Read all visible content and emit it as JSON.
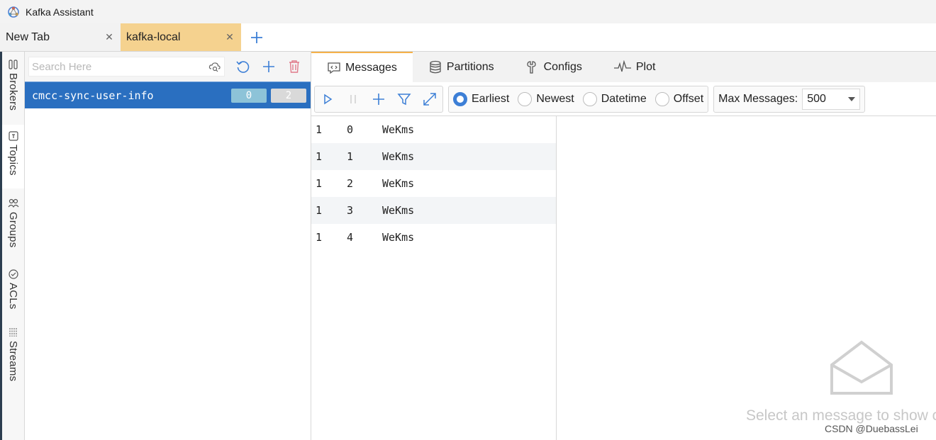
{
  "app": {
    "title": "Kafka Assistant"
  },
  "tabs": [
    {
      "label": "New Tab"
    },
    {
      "label": "kafka-local"
    }
  ],
  "sidebar": {
    "items": [
      {
        "label": "Brokers"
      },
      {
        "label": "Topics"
      },
      {
        "label": "Groups"
      },
      {
        "label": "ACLs"
      },
      {
        "label": "Streams"
      }
    ]
  },
  "topics": {
    "search_placeholder": "Search Here",
    "items": [
      {
        "name": "cmcc-sync-user-info",
        "badge1": "0",
        "badge2": "2"
      }
    ]
  },
  "panel_tabs": [
    {
      "label": "Messages"
    },
    {
      "label": "Partitions"
    },
    {
      "label": "Configs"
    },
    {
      "label": "Plot"
    }
  ],
  "consume": {
    "options": [
      {
        "label": "Earliest",
        "selected": true
      },
      {
        "label": "Newest",
        "selected": false
      },
      {
        "label": "Datetime",
        "selected": false
      },
      {
        "label": "Offset",
        "selected": false
      }
    ],
    "max_label": "Max Messages:",
    "max_value": "500"
  },
  "messages": [
    {
      "partition": "1",
      "offset": "0",
      "value": "WeKms"
    },
    {
      "partition": "1",
      "offset": "1",
      "value": "WeKms"
    },
    {
      "partition": "1",
      "offset": "2",
      "value": "WeKms"
    },
    {
      "partition": "1",
      "offset": "3",
      "value": "WeKms"
    },
    {
      "partition": "1",
      "offset": "4",
      "value": "WeKms"
    }
  ],
  "detail": {
    "empty_text": "Select an message to show c"
  },
  "watermark": "CSDN @DuebassLei",
  "colors": {
    "accent": "#2a6fc0",
    "active_tab": "#f5d28f",
    "tab_indicator": "#f5b14a"
  }
}
